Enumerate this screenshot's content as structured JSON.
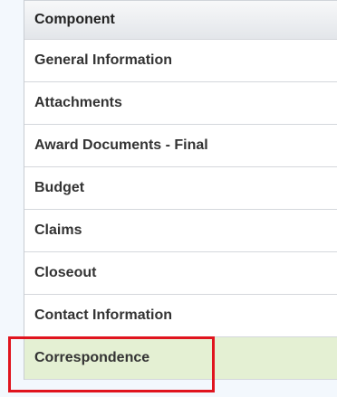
{
  "table": {
    "header": "Component",
    "rows": [
      {
        "label": "General Information",
        "selected": false
      },
      {
        "label": "Attachments",
        "selected": false
      },
      {
        "label": "Award Documents - Final",
        "selected": false
      },
      {
        "label": "Budget",
        "selected": false
      },
      {
        "label": "Claims",
        "selected": false
      },
      {
        "label": "Closeout",
        "selected": false
      },
      {
        "label": "Contact Information",
        "selected": false
      },
      {
        "label": "Correspondence",
        "selected": true
      }
    ]
  },
  "colors": {
    "selected_row": "#e4f0d3",
    "highlight_border": "#e0141e"
  }
}
